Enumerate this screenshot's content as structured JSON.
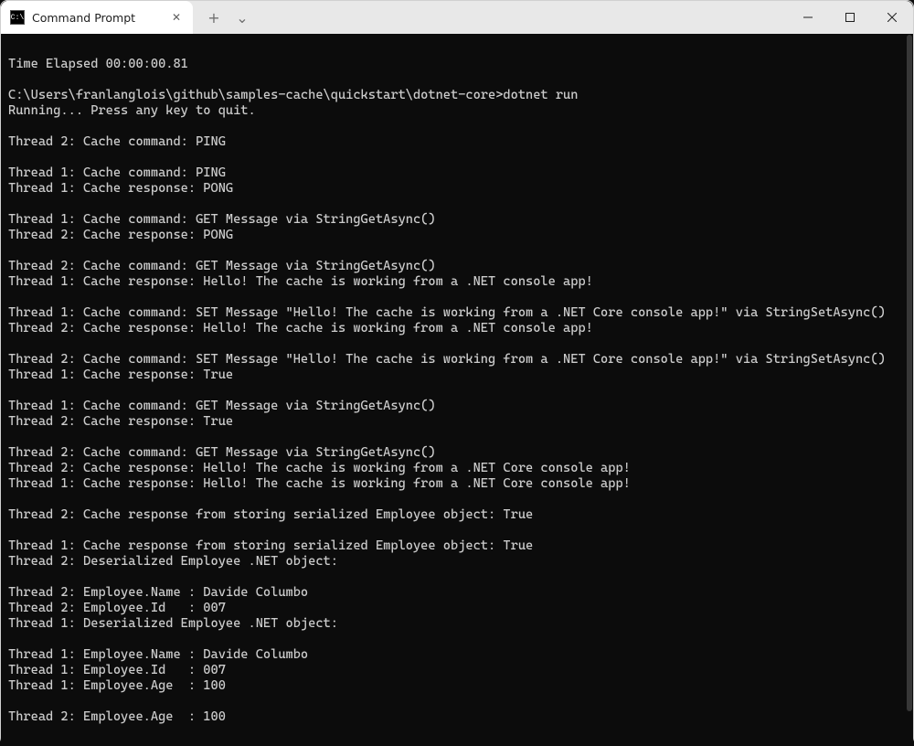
{
  "window": {
    "tab_title": "Command Prompt",
    "tab_icon_text": "C:\\",
    "new_tab_icon": "+",
    "dropdown_icon": "⌄",
    "close_tab_icon": "✕"
  },
  "terminal": {
    "lines": [
      "",
      "Time Elapsed 00:00:00.81",
      "",
      "C:\\Users\\franlanglois\\github\\samples-cache\\quickstart\\dotnet-core>dotnet run",
      "Running... Press any key to quit.",
      "",
      "Thread 2: Cache command: PING",
      "",
      "Thread 1: Cache command: PING",
      "Thread 1: Cache response: PONG",
      "",
      "Thread 1: Cache command: GET Message via StringGetAsync()",
      "Thread 2: Cache response: PONG",
      "",
      "Thread 2: Cache command: GET Message via StringGetAsync()",
      "Thread 1: Cache response: Hello! The cache is working from a .NET console app!",
      "",
      "Thread 1: Cache command: SET Message \"Hello! The cache is working from a .NET Core console app!\" via StringSetAsync()",
      "Thread 2: Cache response: Hello! The cache is working from a .NET console app!",
      "",
      "Thread 2: Cache command: SET Message \"Hello! The cache is working from a .NET Core console app!\" via StringSetAsync()",
      "Thread 1: Cache response: True",
      "",
      "Thread 1: Cache command: GET Message via StringGetAsync()",
      "Thread 2: Cache response: True",
      "",
      "Thread 2: Cache command: GET Message via StringGetAsync()",
      "Thread 2: Cache response: Hello! The cache is working from a .NET Core console app!",
      "Thread 1: Cache response: Hello! The cache is working from a .NET Core console app!",
      "",
      "Thread 2: Cache response from storing serialized Employee object: True",
      "",
      "Thread 1: Cache response from storing serialized Employee object: True",
      "Thread 2: Deserialized Employee .NET object:",
      "",
      "Thread 2: Employee.Name : Davide Columbo",
      "Thread 2: Employee.Id   : 007",
      "Thread 1: Deserialized Employee .NET object:",
      "",
      "Thread 1: Employee.Name : Davide Columbo",
      "Thread 1: Employee.Id   : 007",
      "Thread 1: Employee.Age  : 100",
      "",
      "Thread 2: Employee.Age  : 100"
    ]
  }
}
